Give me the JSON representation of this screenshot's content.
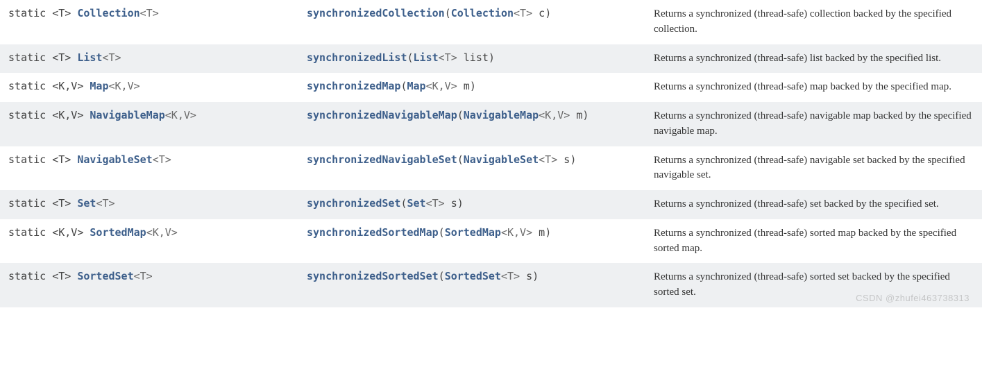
{
  "rows": [
    {
      "modifiers": "static <T> ",
      "returnType": "Collection",
      "returnGeneric": "<T>",
      "method": "synchronizedCollection",
      "paramType": "Collection",
      "paramGeneric": "<T>",
      "paramName": " c",
      "desc": "Returns a synchronized (thread-safe) collection backed by the specified collection."
    },
    {
      "modifiers": "static <T> ",
      "returnType": "List",
      "returnGeneric": "<T>",
      "method": "synchronizedList",
      "paramType": "List",
      "paramGeneric": "<T>",
      "paramName": " list",
      "desc": "Returns a synchronized (thread-safe) list backed by the specified list."
    },
    {
      "modifiers": "static <K,V> ",
      "returnType": "Map",
      "returnGeneric": "<K,V>",
      "method": "synchronizedMap",
      "paramType": "Map",
      "paramGeneric": "<K,V>",
      "paramName": " m",
      "desc": "Returns a synchronized (thread-safe) map backed by the specified map."
    },
    {
      "modifiers": "static <K,V> ",
      "returnType": "NavigableMap",
      "returnGeneric": "<K,V>",
      "method": "synchronizedNavigableMap",
      "paramType": "NavigableMap",
      "paramGeneric": "<K,V>",
      "paramName": " m",
      "desc": "Returns a synchronized (thread-safe) navigable map backed by the specified navigable map."
    },
    {
      "modifiers": "static <T> ",
      "returnType": "NavigableSet",
      "returnGeneric": "<T>",
      "method": "synchronizedNavigableSet",
      "paramType": "NavigableSet",
      "paramGeneric": "<T>",
      "paramName": " s",
      "desc": "Returns a synchronized (thread-safe) navigable set backed by the specified navigable set."
    },
    {
      "modifiers": "static <T> ",
      "returnType": "Set",
      "returnGeneric": "<T>",
      "method": "synchronizedSet",
      "paramType": "Set",
      "paramGeneric": "<T>",
      "paramName": " s",
      "desc": "Returns a synchronized (thread-safe) set backed by the specified set."
    },
    {
      "modifiers": "static <K,V> ",
      "returnType": "SortedMap",
      "returnGeneric": "<K,V>",
      "method": "synchronizedSortedMap",
      "paramType": "SortedMap",
      "paramGeneric": "<K,V>",
      "paramName": " m",
      "desc": "Returns a synchronized (thread-safe) sorted map backed by the specified sorted map."
    },
    {
      "modifiers": "static <T> ",
      "returnType": "SortedSet",
      "returnGeneric": "<T>",
      "method": "synchronizedSortedSet",
      "paramType": "SortedSet",
      "paramGeneric": "<T>",
      "paramName": " s",
      "desc": "Returns a synchronized (thread-safe) sorted set backed by the specified sorted set."
    }
  ],
  "watermark": "CSDN @zhufei463738313",
  "paren_open": "(",
  "paren_close": ")"
}
